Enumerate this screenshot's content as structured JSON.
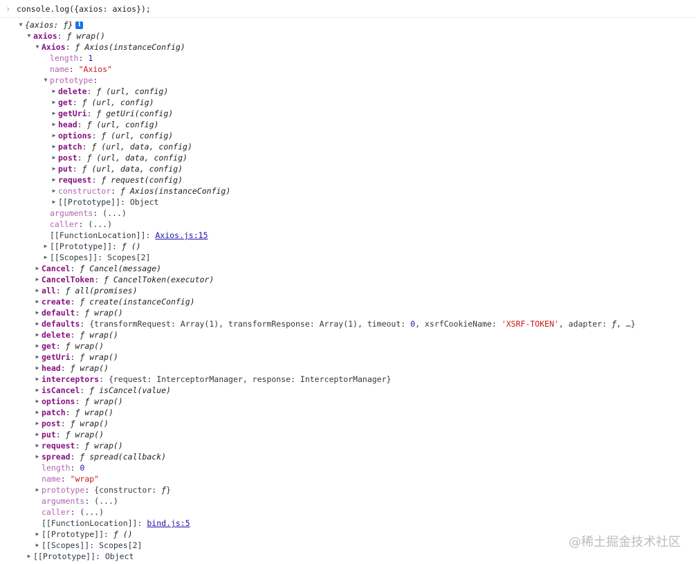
{
  "console_input": "console.log({axios: axios});",
  "prompt_glyph": "›",
  "watermark": "@稀土掘金技术社区",
  "info_badge": "i",
  "rows": [
    {
      "d": 0,
      "arrow": "down",
      "parts": [
        {
          "t": "{axios: ",
          "c": "f"
        },
        {
          "t": "ƒ",
          "c": "f"
        },
        {
          "t": "}",
          "c": "f"
        }
      ],
      "badge": true
    },
    {
      "d": 1,
      "arrow": "down",
      "parts": [
        {
          "t": "axios",
          "c": "k"
        },
        {
          "t": ": ",
          "c": "plain"
        },
        {
          "t": "ƒ wrap()",
          "c": "f"
        }
      ]
    },
    {
      "d": 2,
      "arrow": "down",
      "parts": [
        {
          "t": "Axios",
          "c": "k"
        },
        {
          "t": ": ",
          "c": "plain"
        },
        {
          "t": "ƒ Axios(instanceConfig)",
          "c": "f"
        }
      ]
    },
    {
      "d": 3,
      "arrow": "none",
      "parts": [
        {
          "t": "length",
          "c": "kd"
        },
        {
          "t": ": ",
          "c": "plain"
        },
        {
          "t": "1",
          "c": "num"
        }
      ]
    },
    {
      "d": 3,
      "arrow": "none",
      "parts": [
        {
          "t": "name",
          "c": "kd"
        },
        {
          "t": ": ",
          "c": "plain"
        },
        {
          "t": "\"Axios\"",
          "c": "str"
        }
      ]
    },
    {
      "d": 3,
      "arrow": "down",
      "parts": [
        {
          "t": "prototype",
          "c": "kd"
        },
        {
          "t": ":",
          "c": "plain"
        }
      ]
    },
    {
      "d": 4,
      "arrow": "right",
      "parts": [
        {
          "t": "delete",
          "c": "k"
        },
        {
          "t": ": ",
          "c": "plain"
        },
        {
          "t": "ƒ (url, config)",
          "c": "f"
        }
      ]
    },
    {
      "d": 4,
      "arrow": "right",
      "parts": [
        {
          "t": "get",
          "c": "k"
        },
        {
          "t": ": ",
          "c": "plain"
        },
        {
          "t": "ƒ (url, config)",
          "c": "f"
        }
      ]
    },
    {
      "d": 4,
      "arrow": "right",
      "parts": [
        {
          "t": "getUri",
          "c": "k"
        },
        {
          "t": ": ",
          "c": "plain"
        },
        {
          "t": "ƒ getUri(config)",
          "c": "f"
        }
      ]
    },
    {
      "d": 4,
      "arrow": "right",
      "parts": [
        {
          "t": "head",
          "c": "k"
        },
        {
          "t": ": ",
          "c": "plain"
        },
        {
          "t": "ƒ (url, config)",
          "c": "f"
        }
      ]
    },
    {
      "d": 4,
      "arrow": "right",
      "parts": [
        {
          "t": "options",
          "c": "k"
        },
        {
          "t": ": ",
          "c": "plain"
        },
        {
          "t": "ƒ (url, config)",
          "c": "f"
        }
      ]
    },
    {
      "d": 4,
      "arrow": "right",
      "parts": [
        {
          "t": "patch",
          "c": "k"
        },
        {
          "t": ": ",
          "c": "plain"
        },
        {
          "t": "ƒ (url, data, config)",
          "c": "f"
        }
      ]
    },
    {
      "d": 4,
      "arrow": "right",
      "parts": [
        {
          "t": "post",
          "c": "k"
        },
        {
          "t": ": ",
          "c": "plain"
        },
        {
          "t": "ƒ (url, data, config)",
          "c": "f"
        }
      ]
    },
    {
      "d": 4,
      "arrow": "right",
      "parts": [
        {
          "t": "put",
          "c": "k"
        },
        {
          "t": ": ",
          "c": "plain"
        },
        {
          "t": "ƒ (url, data, config)",
          "c": "f"
        }
      ]
    },
    {
      "d": 4,
      "arrow": "right",
      "parts": [
        {
          "t": "request",
          "c": "k"
        },
        {
          "t": ": ",
          "c": "plain"
        },
        {
          "t": "ƒ request(config)",
          "c": "f"
        }
      ]
    },
    {
      "d": 4,
      "arrow": "right",
      "parts": [
        {
          "t": "constructor",
          "c": "kd"
        },
        {
          "t": ": ",
          "c": "plain"
        },
        {
          "t": "ƒ Axios(instanceConfig)",
          "c": "f"
        }
      ]
    },
    {
      "d": 4,
      "arrow": "right",
      "parts": [
        {
          "t": "[[Prototype]]",
          "c": "plain"
        },
        {
          "t": ": ",
          "c": "plain"
        },
        {
          "t": "Object",
          "c": "plain"
        }
      ]
    },
    {
      "d": 3,
      "arrow": "none",
      "parts": [
        {
          "t": "arguments",
          "c": "kd"
        },
        {
          "t": ": ",
          "c": "plain"
        },
        {
          "t": "(...)",
          "c": "plain"
        }
      ]
    },
    {
      "d": 3,
      "arrow": "none",
      "parts": [
        {
          "t": "caller",
          "c": "kd"
        },
        {
          "t": ": ",
          "c": "plain"
        },
        {
          "t": "(...)",
          "c": "plain"
        }
      ]
    },
    {
      "d": 3,
      "arrow": "none",
      "parts": [
        {
          "t": "[[FunctionLocation]]",
          "c": "plain"
        },
        {
          "t": ": ",
          "c": "plain"
        },
        {
          "t": "Axios.js:15",
          "c": "link"
        }
      ]
    },
    {
      "d": 3,
      "arrow": "right",
      "parts": [
        {
          "t": "[[Prototype]]",
          "c": "plain"
        },
        {
          "t": ": ",
          "c": "plain"
        },
        {
          "t": "ƒ ()",
          "c": "f"
        }
      ]
    },
    {
      "d": 3,
      "arrow": "right",
      "parts": [
        {
          "t": "[[Scopes]]",
          "c": "plain"
        },
        {
          "t": ": ",
          "c": "plain"
        },
        {
          "t": "Scopes[2]",
          "c": "plain"
        }
      ]
    },
    {
      "d": 2,
      "arrow": "right",
      "parts": [
        {
          "t": "Cancel",
          "c": "k"
        },
        {
          "t": ": ",
          "c": "plain"
        },
        {
          "t": "ƒ Cancel(message)",
          "c": "f"
        }
      ]
    },
    {
      "d": 2,
      "arrow": "right",
      "parts": [
        {
          "t": "CancelToken",
          "c": "k"
        },
        {
          "t": ": ",
          "c": "plain"
        },
        {
          "t": "ƒ CancelToken(executor)",
          "c": "f"
        }
      ]
    },
    {
      "d": 2,
      "arrow": "right",
      "parts": [
        {
          "t": "all",
          "c": "k"
        },
        {
          "t": ": ",
          "c": "plain"
        },
        {
          "t": "ƒ all(promises)",
          "c": "f"
        }
      ]
    },
    {
      "d": 2,
      "arrow": "right",
      "parts": [
        {
          "t": "create",
          "c": "k"
        },
        {
          "t": ": ",
          "c": "plain"
        },
        {
          "t": "ƒ create(instanceConfig)",
          "c": "f"
        }
      ]
    },
    {
      "d": 2,
      "arrow": "right",
      "parts": [
        {
          "t": "default",
          "c": "k"
        },
        {
          "t": ": ",
          "c": "plain"
        },
        {
          "t": "ƒ wrap()",
          "c": "f"
        }
      ]
    },
    {
      "d": 2,
      "arrow": "right",
      "parts": [
        {
          "t": "defaults",
          "c": "k"
        },
        {
          "t": ": ",
          "c": "plain"
        },
        {
          "t": "{transformRequest: Array(1), transformResponse: Array(1), timeout: ",
          "c": "plain"
        },
        {
          "t": "0",
          "c": "num"
        },
        {
          "t": ", xsrfCookieName: ",
          "c": "plain"
        },
        {
          "t": "'XSRF-TOKEN'",
          "c": "str"
        },
        {
          "t": ", adapter: ",
          "c": "plain"
        },
        {
          "t": "ƒ",
          "c": "f"
        },
        {
          "t": ", …}",
          "c": "plain"
        }
      ]
    },
    {
      "d": 2,
      "arrow": "right",
      "parts": [
        {
          "t": "delete",
          "c": "k"
        },
        {
          "t": ": ",
          "c": "plain"
        },
        {
          "t": "ƒ wrap()",
          "c": "f"
        }
      ]
    },
    {
      "d": 2,
      "arrow": "right",
      "parts": [
        {
          "t": "get",
          "c": "k"
        },
        {
          "t": ": ",
          "c": "plain"
        },
        {
          "t": "ƒ wrap()",
          "c": "f"
        }
      ]
    },
    {
      "d": 2,
      "arrow": "right",
      "parts": [
        {
          "t": "getUri",
          "c": "k"
        },
        {
          "t": ": ",
          "c": "plain"
        },
        {
          "t": "ƒ wrap()",
          "c": "f"
        }
      ]
    },
    {
      "d": 2,
      "arrow": "right",
      "parts": [
        {
          "t": "head",
          "c": "k"
        },
        {
          "t": ": ",
          "c": "plain"
        },
        {
          "t": "ƒ wrap()",
          "c": "f"
        }
      ]
    },
    {
      "d": 2,
      "arrow": "right",
      "parts": [
        {
          "t": "interceptors",
          "c": "k"
        },
        {
          "t": ": ",
          "c": "plain"
        },
        {
          "t": "{request: InterceptorManager, response: InterceptorManager}",
          "c": "plain"
        }
      ]
    },
    {
      "d": 2,
      "arrow": "right",
      "parts": [
        {
          "t": "isCancel",
          "c": "k"
        },
        {
          "t": ": ",
          "c": "plain"
        },
        {
          "t": "ƒ isCancel(value)",
          "c": "f"
        }
      ]
    },
    {
      "d": 2,
      "arrow": "right",
      "parts": [
        {
          "t": "options",
          "c": "k"
        },
        {
          "t": ": ",
          "c": "plain"
        },
        {
          "t": "ƒ wrap()",
          "c": "f"
        }
      ]
    },
    {
      "d": 2,
      "arrow": "right",
      "parts": [
        {
          "t": "patch",
          "c": "k"
        },
        {
          "t": ": ",
          "c": "plain"
        },
        {
          "t": "ƒ wrap()",
          "c": "f"
        }
      ]
    },
    {
      "d": 2,
      "arrow": "right",
      "parts": [
        {
          "t": "post",
          "c": "k"
        },
        {
          "t": ": ",
          "c": "plain"
        },
        {
          "t": "ƒ wrap()",
          "c": "f"
        }
      ]
    },
    {
      "d": 2,
      "arrow": "right",
      "parts": [
        {
          "t": "put",
          "c": "k"
        },
        {
          "t": ": ",
          "c": "plain"
        },
        {
          "t": "ƒ wrap()",
          "c": "f"
        }
      ]
    },
    {
      "d": 2,
      "arrow": "right",
      "parts": [
        {
          "t": "request",
          "c": "k"
        },
        {
          "t": ": ",
          "c": "plain"
        },
        {
          "t": "ƒ wrap()",
          "c": "f"
        }
      ]
    },
    {
      "d": 2,
      "arrow": "right",
      "parts": [
        {
          "t": "spread",
          "c": "k"
        },
        {
          "t": ": ",
          "c": "plain"
        },
        {
          "t": "ƒ spread(callback)",
          "c": "f"
        }
      ]
    },
    {
      "d": 2,
      "arrow": "none",
      "parts": [
        {
          "t": "length",
          "c": "kd"
        },
        {
          "t": ": ",
          "c": "plain"
        },
        {
          "t": "0",
          "c": "num"
        }
      ]
    },
    {
      "d": 2,
      "arrow": "none",
      "parts": [
        {
          "t": "name",
          "c": "kd"
        },
        {
          "t": ": ",
          "c": "plain"
        },
        {
          "t": "\"wrap\"",
          "c": "str"
        }
      ]
    },
    {
      "d": 2,
      "arrow": "right",
      "parts": [
        {
          "t": "prototype",
          "c": "kd"
        },
        {
          "t": ": ",
          "c": "plain"
        },
        {
          "t": "{constructor: ",
          "c": "plain"
        },
        {
          "t": "ƒ",
          "c": "f"
        },
        {
          "t": "}",
          "c": "plain"
        }
      ]
    },
    {
      "d": 2,
      "arrow": "none",
      "parts": [
        {
          "t": "arguments",
          "c": "kd"
        },
        {
          "t": ": ",
          "c": "plain"
        },
        {
          "t": "(...)",
          "c": "plain"
        }
      ]
    },
    {
      "d": 2,
      "arrow": "none",
      "parts": [
        {
          "t": "caller",
          "c": "kd"
        },
        {
          "t": ": ",
          "c": "plain"
        },
        {
          "t": "(...)",
          "c": "plain"
        }
      ]
    },
    {
      "d": 2,
      "arrow": "none",
      "parts": [
        {
          "t": "[[FunctionLocation]]",
          "c": "plain"
        },
        {
          "t": ": ",
          "c": "plain"
        },
        {
          "t": "bind.js:5",
          "c": "link"
        }
      ]
    },
    {
      "d": 2,
      "arrow": "right",
      "parts": [
        {
          "t": "[[Prototype]]",
          "c": "plain"
        },
        {
          "t": ": ",
          "c": "plain"
        },
        {
          "t": "ƒ ()",
          "c": "f"
        }
      ]
    },
    {
      "d": 2,
      "arrow": "right",
      "parts": [
        {
          "t": "[[Scopes]]",
          "c": "plain"
        },
        {
          "t": ": ",
          "c": "plain"
        },
        {
          "t": "Scopes[2]",
          "c": "plain"
        }
      ]
    },
    {
      "d": 1,
      "arrow": "right",
      "parts": [
        {
          "t": "[[Prototype]]",
          "c": "plain"
        },
        {
          "t": ": ",
          "c": "plain"
        },
        {
          "t": "Object",
          "c": "plain"
        }
      ]
    }
  ]
}
